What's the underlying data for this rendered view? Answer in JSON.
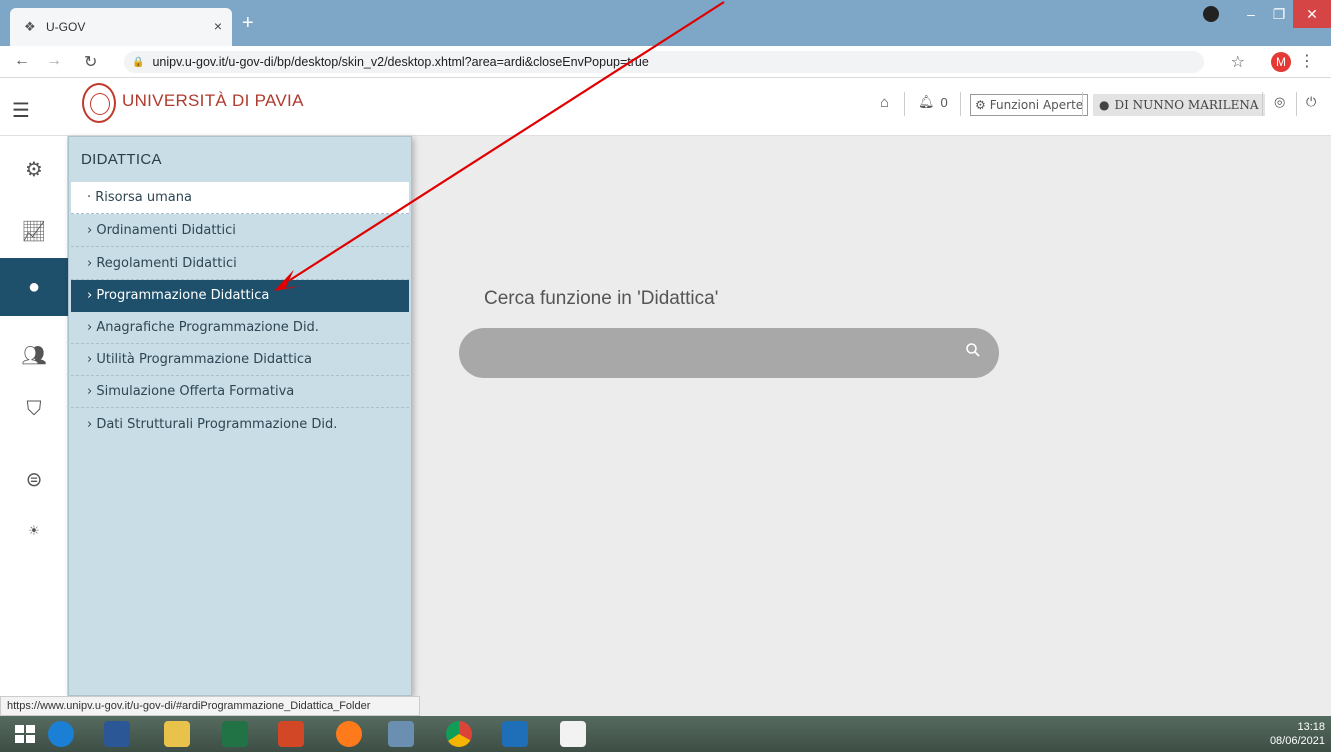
{
  "browser": {
    "tab_title": "U-GOV",
    "tab_close": "×",
    "new_tab": "+",
    "url": "unipv.u-gov.it/u-gov-di/bp/desktop/skin_v2/desktop.xhtml?area=ardi&closeEnvPopup=true",
    "profile_initial": "M",
    "status_link": "https://www.unipv.u-gov.it/u-gov-di/#ardiProgrammazione_Didattica_Folder"
  },
  "header": {
    "logo_text": "UNIVERSITÀ DI PAVIA",
    "notifications_count": "0",
    "funzioni_label": "Funzioni Aperte",
    "user_name": "DI NUNNO MARILENA"
  },
  "menu": {
    "title": "DIDATTICA",
    "items": [
      {
        "label": "· Risorsa umana"
      },
      {
        "label": "› Ordinamenti Didattici"
      },
      {
        "label": "› Regolamenti Didattici"
      },
      {
        "label": "› Programmazione Didattica"
      },
      {
        "label": "› Anagrafiche Programmazione Did."
      },
      {
        "label": "› Utilità Programmazione Didattica"
      },
      {
        "label": "› Simulazione Offerta Formativa"
      },
      {
        "label": "› Dati Strutturali Programmazione Did."
      }
    ]
  },
  "search": {
    "label": "Cerca funzione in 'Didattica'",
    "placeholder": ""
  },
  "taskbar": {
    "time": "13:18",
    "date": "08/06/2021"
  },
  "colors": {
    "accent": "#1e4f6b",
    "menu_bg": "#c8dde6",
    "logo_red": "#b03a2e",
    "annotation": "#e00000"
  }
}
